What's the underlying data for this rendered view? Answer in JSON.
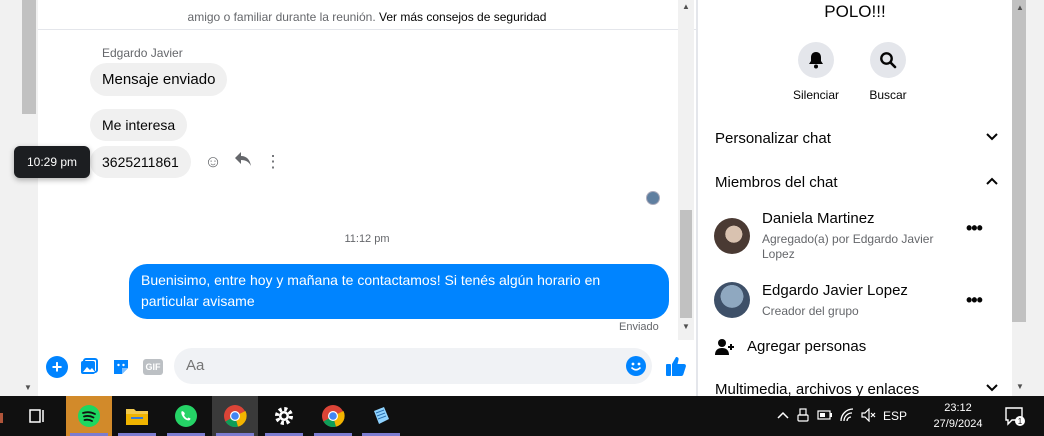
{
  "banner": {
    "text": "amigo o familiar durante la reunión.",
    "link": "Ver más consejos de seguridad"
  },
  "conversation": {
    "sender_name": "Edgardo Javier",
    "messages": [
      "Mensaje enviado",
      "Me interesa",
      "3625211861"
    ],
    "tooltip_time": "10:29 pm",
    "divider_time": "11:12 pm",
    "my_message": "Buenisimo, entre hoy y mañana te contactamos! Si tenés algún horario en particular avisame",
    "sent_status": "Enviado"
  },
  "composer": {
    "placeholder": "Aa",
    "gif_label": "GIF"
  },
  "info_panel": {
    "title": "POLO!!!",
    "actions": {
      "mute": "Silenciar",
      "search": "Buscar"
    },
    "sections": {
      "customize": "Personalizar chat",
      "members": "Miembros del chat",
      "media": "Multimedia, archivos y enlaces"
    },
    "members": [
      {
        "name": "Daniela Martinez",
        "sub": "Agregado(a) por Edgardo Javier Lopez"
      },
      {
        "name": "Edgardo Javier Lopez",
        "sub": "Creador del grupo"
      }
    ],
    "add_people": "Agregar personas"
  },
  "taskbar": {
    "language": "ESP",
    "time": "23:12",
    "date": "27/9/2024",
    "notification_count": "1"
  },
  "colors": {
    "accent": "#0084ff",
    "bubble_gray": "#f0f0f0",
    "taskbar": "#101010"
  }
}
